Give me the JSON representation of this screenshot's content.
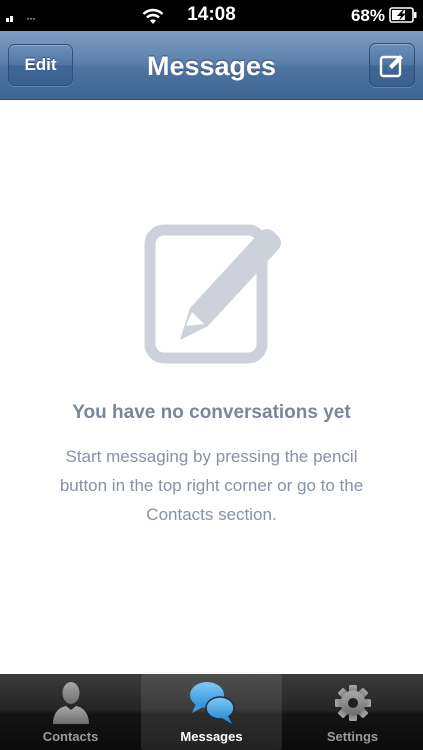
{
  "status_bar": {
    "time": "14:08",
    "battery_percent": "68%",
    "battery_level": 0.68
  },
  "nav_bar": {
    "title": "Messages",
    "edit_label": "Edit",
    "compose_icon": "compose-icon"
  },
  "empty_state": {
    "icon": "compose-large-icon",
    "title": "You have no conversations yet",
    "body": "Start messaging by pressing the pencil button in the top right corner or go to the Contacts section."
  },
  "tab_bar": {
    "tabs": [
      {
        "label": "Contacts",
        "icon": "person-icon"
      },
      {
        "label": "Messages",
        "icon": "chat-bubbles-icon"
      },
      {
        "label": "Settings",
        "icon": "gear-icon"
      }
    ],
    "active_index": 1
  },
  "colors": {
    "nav_blue": "#5e82ad",
    "empty_text": "#7a879a",
    "tab_active_blue": "#3aa2e6"
  }
}
